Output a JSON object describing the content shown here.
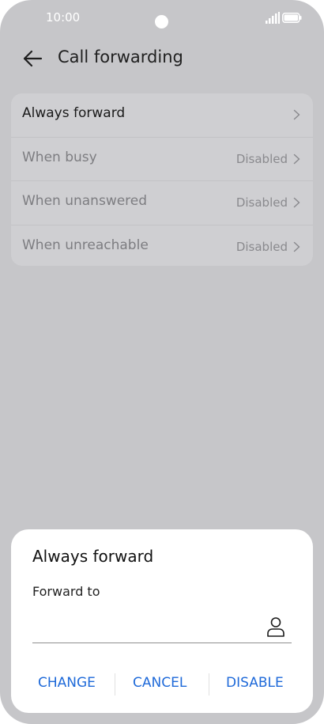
{
  "status_bar": {
    "time": "10:00"
  },
  "header": {
    "title": "Call forwarding"
  },
  "settings": {
    "rows": [
      {
        "label": "Always forward",
        "value": ""
      },
      {
        "label": "When busy",
        "value": "Disabled"
      },
      {
        "label": "When unanswered",
        "value": "Disabled"
      },
      {
        "label": "When unreachable",
        "value": "Disabled"
      }
    ]
  },
  "dialog": {
    "title": "Always forward",
    "field_label": "Forward to",
    "field_value": "",
    "buttons": {
      "change": "CHANGE",
      "cancel": "CANCEL",
      "disable": "DISABLE"
    }
  },
  "colors": {
    "accent": "#1f6ad9",
    "scrim": "#c6c6c9"
  }
}
